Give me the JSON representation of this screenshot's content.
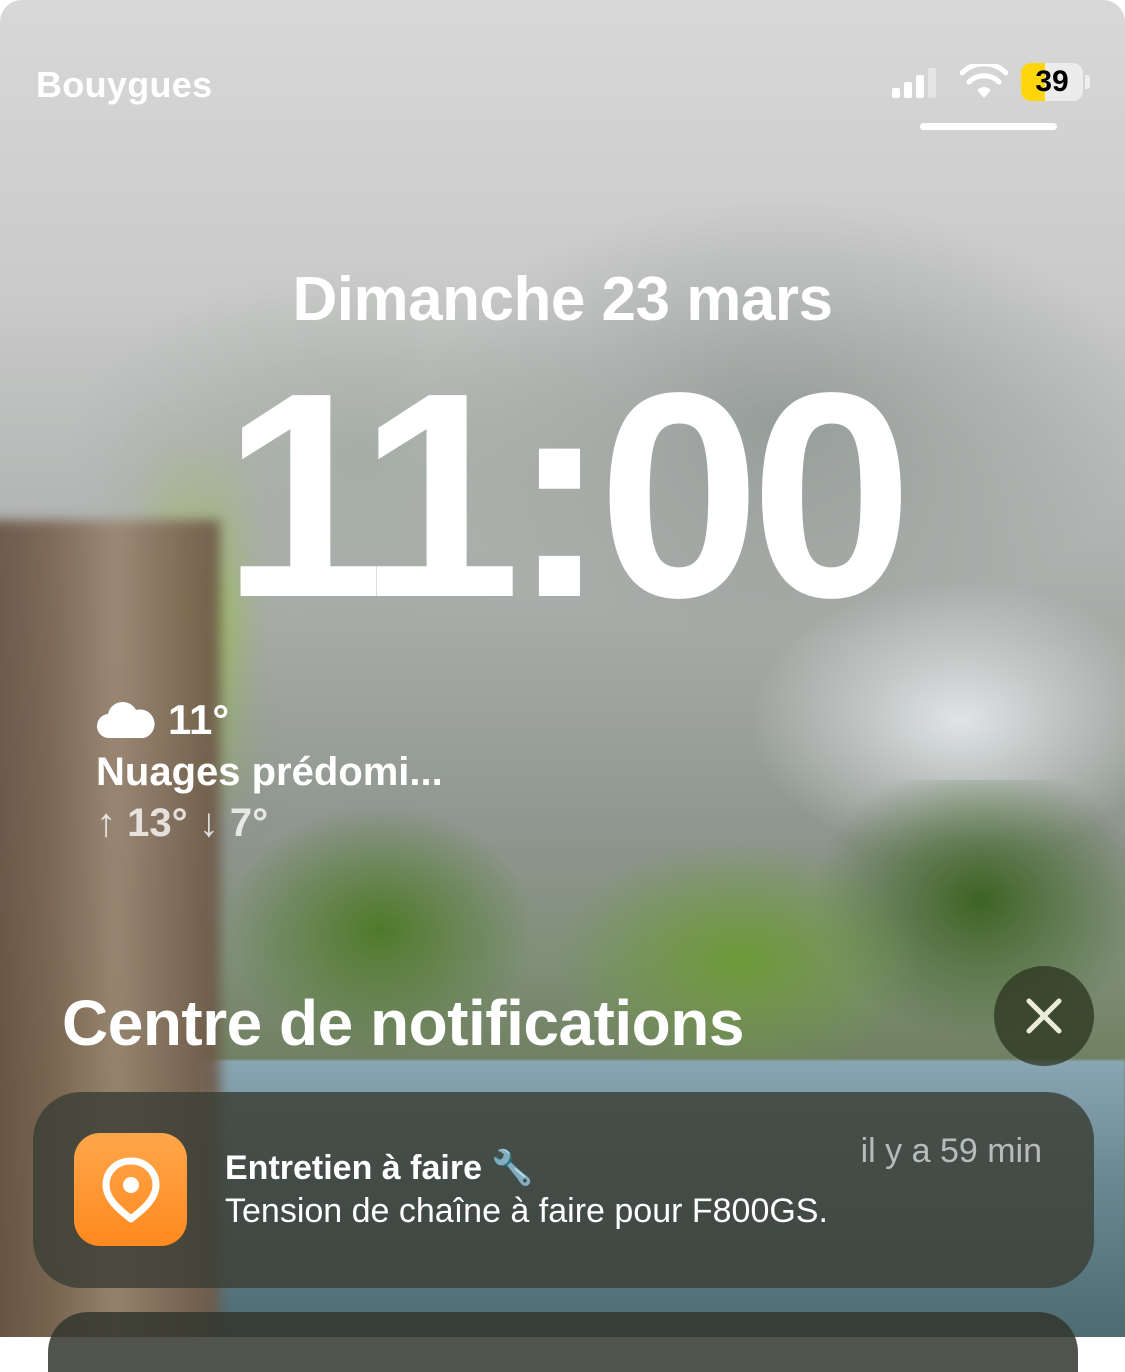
{
  "status_bar": {
    "carrier": "Bouygues",
    "battery_level": "39",
    "battery_fraction": 0.39,
    "battery_color": "#ffd60a",
    "signal_icon": "signal-icon",
    "wifi_icon": "wifi-icon"
  },
  "lock_screen": {
    "date": "Dimanche 23 mars",
    "time": "11:00"
  },
  "weather": {
    "icon": "cloud-icon",
    "temperature": "11°",
    "condition": "Nuages prédomi...",
    "range": "↑ 13° ↓ 7°"
  },
  "notification_center": {
    "title": "Centre de notifications",
    "close_icon": "close-icon"
  },
  "notifications": [
    {
      "app_icon": "location-pin-icon",
      "app_color": "#ff8a1f",
      "title": "Entretien à faire 🔧",
      "time_ago": "il y a 59 min",
      "body": "Tension de chaîne à faire pour F800GS."
    }
  ]
}
